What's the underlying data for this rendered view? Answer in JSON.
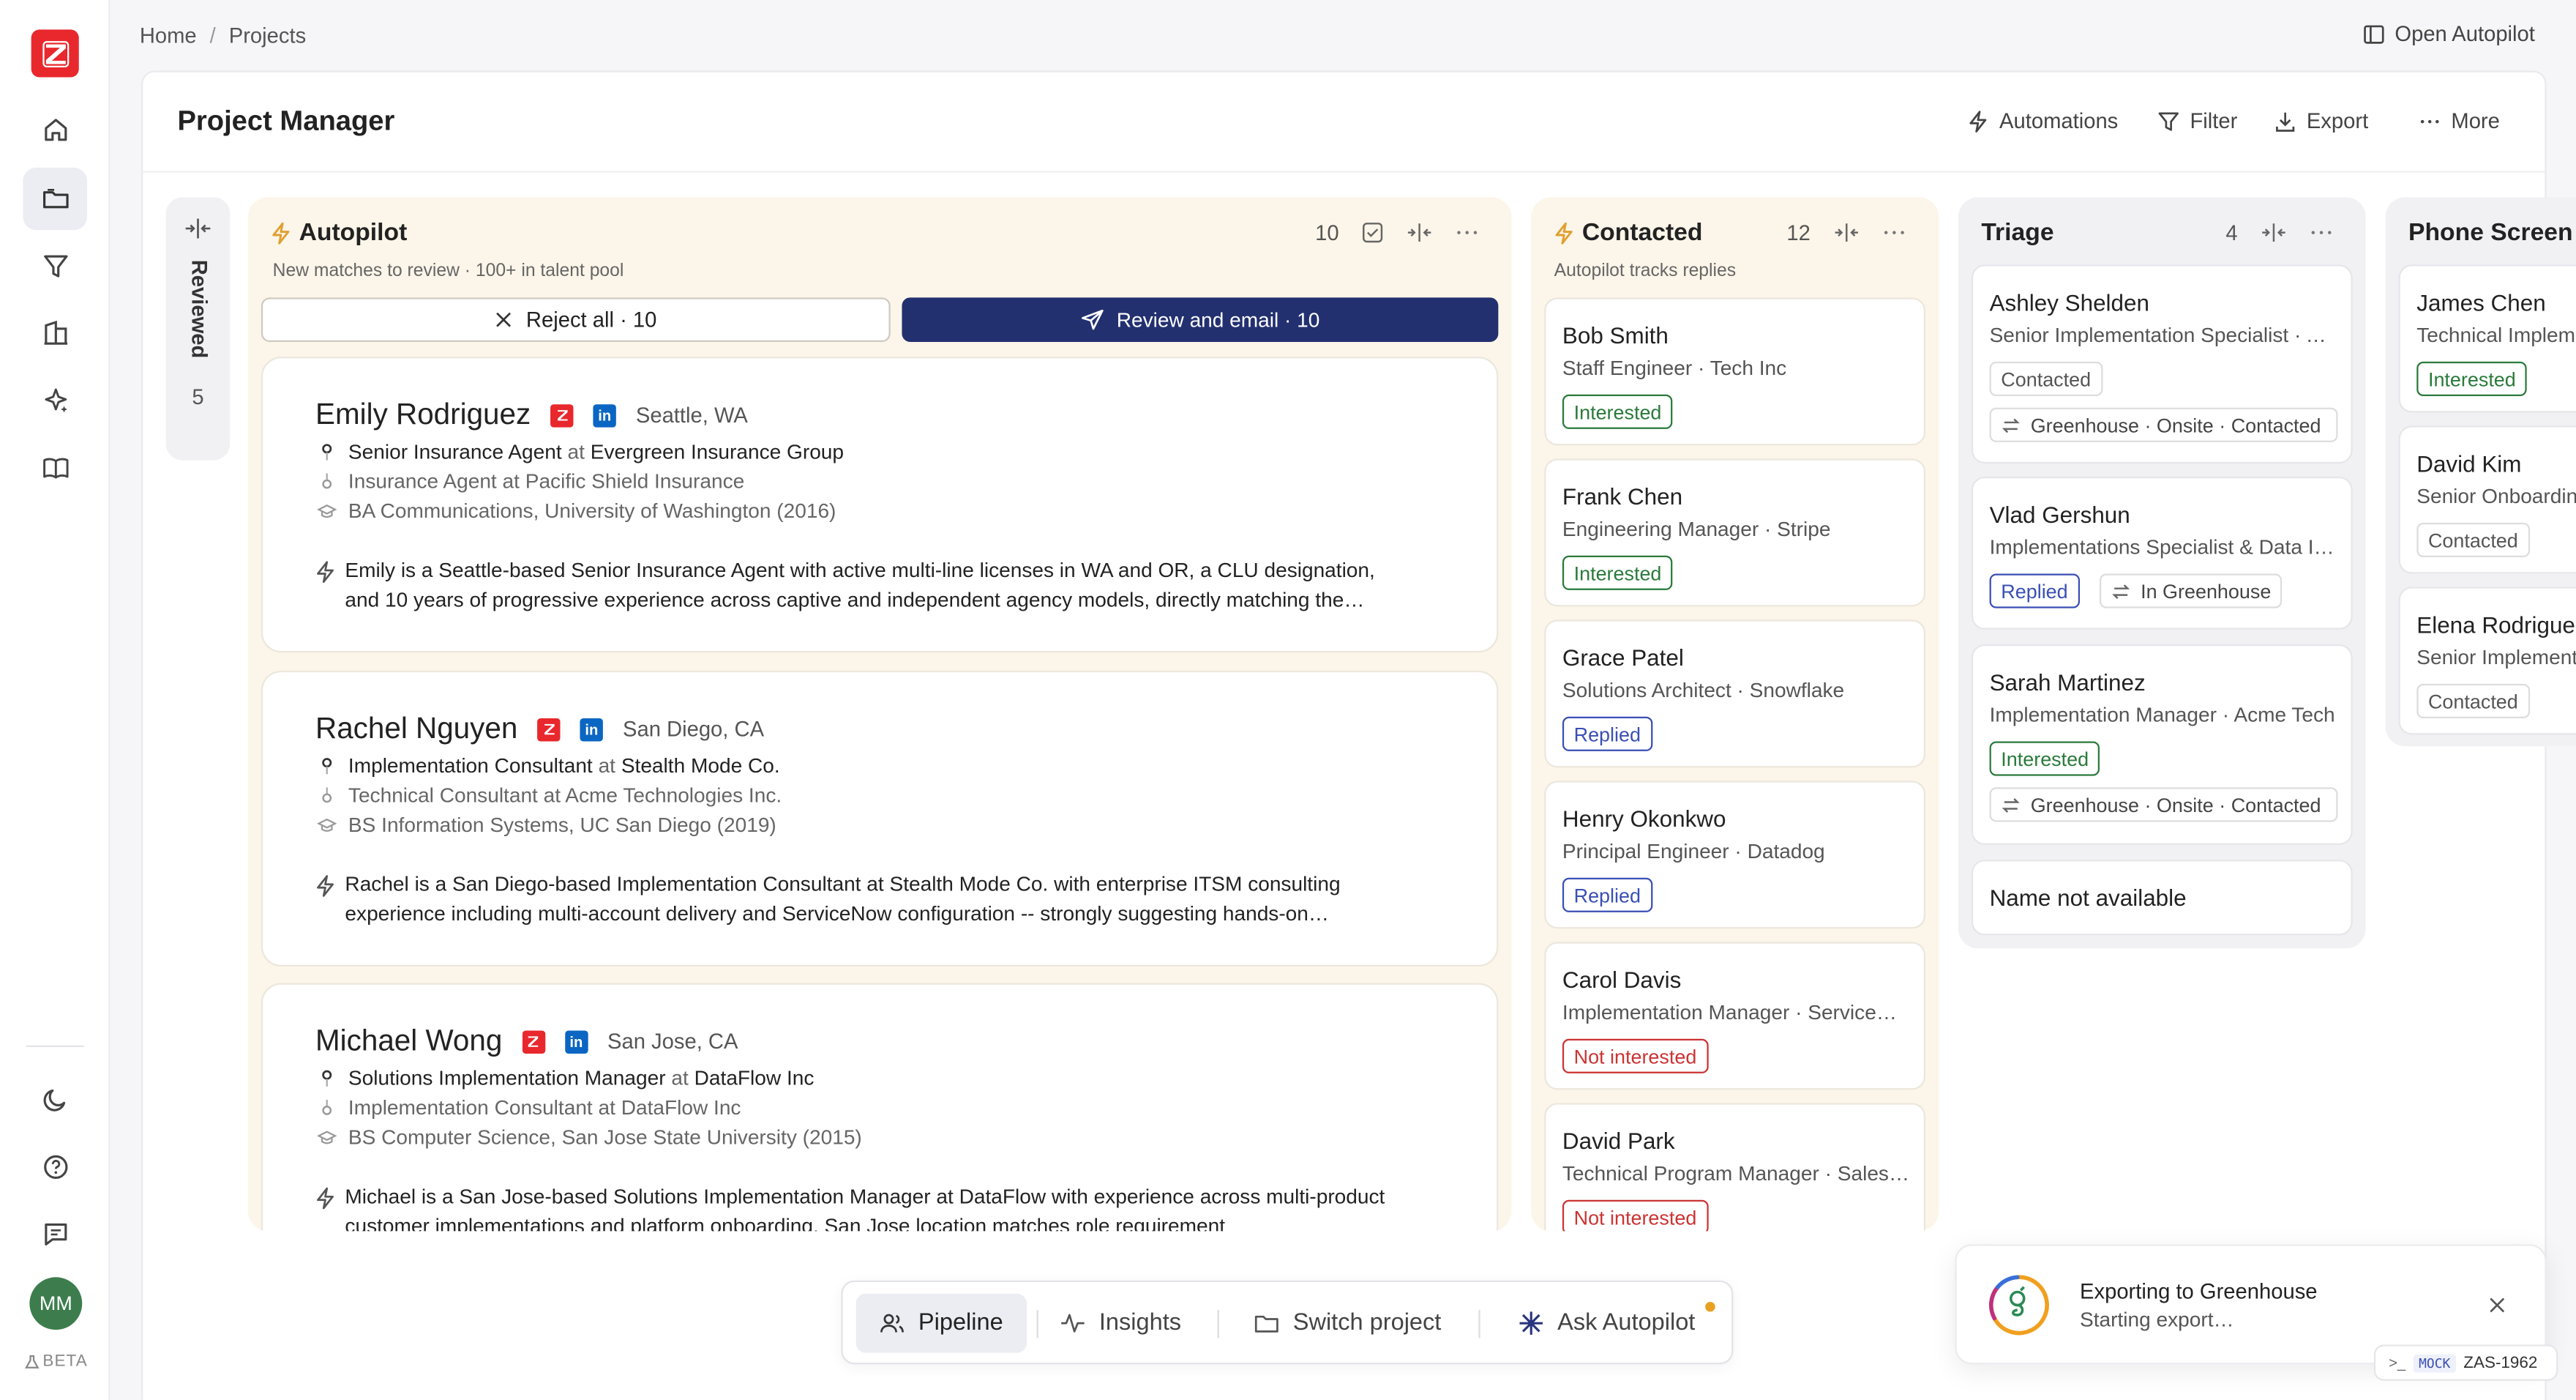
{
  "breadcrumb": {
    "home": "Home",
    "sep": "/",
    "current": "Projects"
  },
  "header": {
    "open_autopilot": "Open Autopilot",
    "title": "Project Manager",
    "automations": "Automations",
    "filter": "Filter",
    "export": "Export",
    "more": "More"
  },
  "reviewed": {
    "label": "Reviewed",
    "count": "5"
  },
  "autopilot": {
    "title": "Autopilot",
    "count": "10",
    "subtitle": "New matches to review · 100+ in talent pool",
    "reject": "Reject all · 10",
    "review": "Review and email · 10",
    "candidates": [
      {
        "name": "Emily Rodriguez",
        "location": "Seattle, WA",
        "role": "Senior Insurance Agent",
        "company": "Evergreen Insurance Group",
        "at": "at",
        "prev": "Insurance Agent at Pacific Shield Insurance",
        "edu": "BA Communications, University of Washington (2016)",
        "summary": "Emily is a Seattle-based Senior Insurance Agent with active multi-line licenses in WA and OR, a CLU designation, and 10 years of progressive experience across captive and independent agency models, directly matching the…"
      },
      {
        "name": "Rachel Nguyen",
        "location": "San Diego, CA",
        "role": "Implementation Consultant",
        "company": "Stealth Mode Co.",
        "at": "at",
        "prev": "Technical Consultant at Acme Technologies Inc.",
        "edu": "BS Information Systems, UC San Diego (2019)",
        "summary": "Rachel is a San Diego-based Implementation Consultant at Stealth Mode Co. with enterprise ITSM consulting experience including multi-account delivery and ServiceNow configuration -- strongly suggesting hands-on…"
      },
      {
        "name": "Michael Wong",
        "location": "San Jose, CA",
        "role": "Solutions Implementation Manager",
        "company": "DataFlow Inc",
        "at": "at",
        "prev": "Implementation Consultant at DataFlow Inc",
        "edu": "BS Computer Science, San Jose State University (2015)",
        "summary": "Michael is a San Jose-based Solutions Implementation Manager at DataFlow with experience across multi-product customer implementations and platform onboarding. San Jose location matches role requirement"
      }
    ]
  },
  "contacted": {
    "title": "Contacted",
    "count": "12",
    "subtitle": "Autopilot tracks replies",
    "cards": [
      {
        "name": "Bob Smith",
        "role": "Staff Engineer · Tech Inc",
        "status": "Interested"
      },
      {
        "name": "Frank Chen",
        "role": "Engineering Manager · Stripe",
        "status": "Interested"
      },
      {
        "name": "Grace Patel",
        "role": "Solutions Architect · Snowflake",
        "status": "Replied"
      },
      {
        "name": "Henry Okonkwo",
        "role": "Principal Engineer · Datadog",
        "status": "Replied"
      },
      {
        "name": "Carol Davis",
        "role": "Implementation Manager · ServiceNow",
        "status": "Not interested"
      },
      {
        "name": "David Park",
        "role": "Technical Program Manager · Salesforce",
        "status": "Not interested"
      }
    ]
  },
  "triage": {
    "title": "Triage",
    "count": "4",
    "cards": [
      {
        "name": "Ashley Shelden",
        "role": "Senior Implementation Specialist · Acme",
        "status": "Contacted",
        "gh": "Greenhouse · Onsite · Contacted"
      },
      {
        "name": "Vlad Gershun",
        "role": "Implementations Specialist & Data Integration",
        "status": "Replied",
        "gh": "In Greenhouse"
      },
      {
        "name": "Sarah Martinez",
        "role": "Implementation Manager · Acme Tech",
        "status": "Interested",
        "gh": "Greenhouse · Onsite · Contacted"
      },
      {
        "name": "Name not available"
      }
    ]
  },
  "phone": {
    "title": "Phone Screen",
    "cards": [
      {
        "name": "James Chen",
        "role": "Technical Implementation",
        "status": "Interested"
      },
      {
        "name": "David Kim",
        "role": "Senior Onboarding",
        "status": "Contacted"
      },
      {
        "name": "Elena Rodriguez",
        "role": "Senior Implementation",
        "status": "Contacted"
      }
    ]
  },
  "bottom": {
    "pipeline": "Pipeline",
    "insights": "Insights",
    "switch": "Switch project",
    "ask": "Ask Autopilot"
  },
  "toast": {
    "title": "Exporting to Greenhouse",
    "subtitle": "Starting export…"
  },
  "mock": {
    "badge": "MOCK",
    "id": "ZAS-1962"
  },
  "user": {
    "initials": "MM",
    "beta": "BETA"
  },
  "colors": {
    "accent": "#233070",
    "brand": "#e8282d",
    "autopilot_bg": "#fcf5e9",
    "interested": "#2a7a3b",
    "replied": "#3a4fb5",
    "not_interested": "#cc3333"
  }
}
